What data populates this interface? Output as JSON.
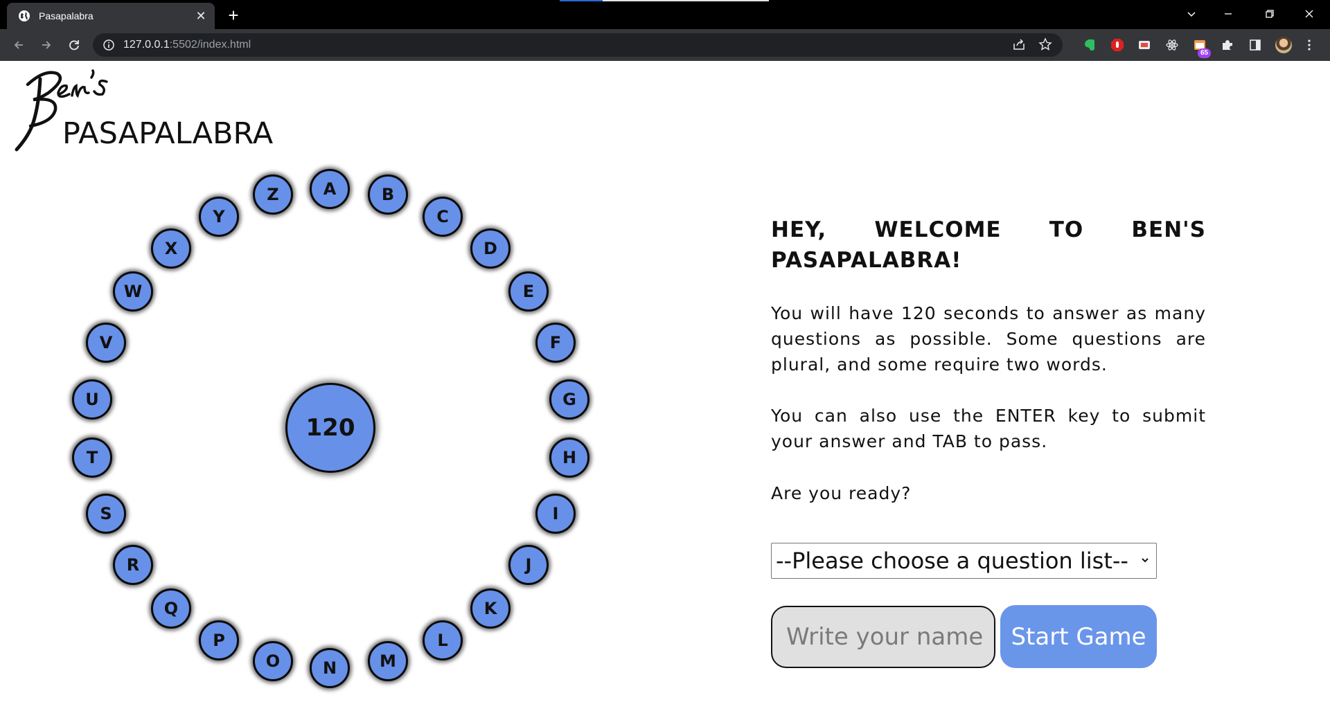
{
  "browser": {
    "tab_title": "Pasapalabra",
    "url_host": "127.0.0.1",
    "url_path": ":5502/index.html",
    "extension_badge": "65"
  },
  "logo": {
    "script_text": "Ben's",
    "title": "PASAPALABRA"
  },
  "rosco": {
    "timer": "120",
    "letters": [
      "A",
      "B",
      "C",
      "D",
      "E",
      "F",
      "G",
      "H",
      "I",
      "J",
      "K",
      "L",
      "M",
      "N",
      "O",
      "P",
      "Q",
      "R",
      "S",
      "T",
      "U",
      "V",
      "W",
      "X",
      "Y",
      "Z"
    ],
    "color": "#6790e8"
  },
  "welcome": {
    "heading_words": [
      "HEY,",
      "WELCOME",
      "TO",
      "BEN'S"
    ],
    "heading_line2": "PASAPALABRA!",
    "paragraph1": "You will have 120 seconds to answer as many questions as possible. Some questions are plural, and some require two words.",
    "paragraph2": "You can also use the ENTER key to submit your answer and TAB to pass.",
    "paragraph3": "Are you ready?"
  },
  "controls": {
    "select_value": "--Please choose a question list--",
    "name_placeholder": "Write your name",
    "start_label": "Start Game",
    "button_color": "#6a96ea"
  }
}
